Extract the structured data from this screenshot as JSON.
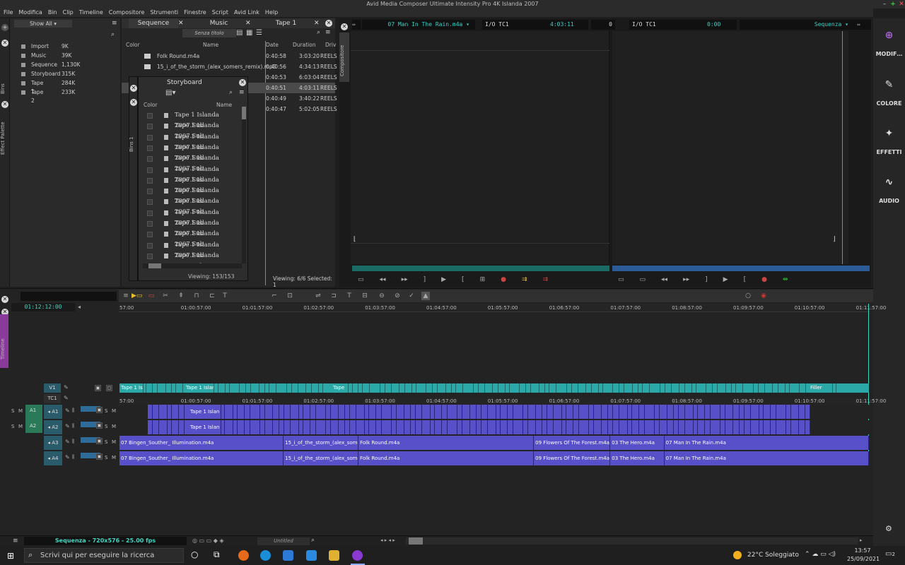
{
  "app": {
    "title": "Avid Media Composer Ultimate Intensity Pro 4K  Islanda 2007",
    "menu": [
      "File",
      "Modifica",
      "Bin",
      "Clip",
      "Timeline",
      "Compositore",
      "Strumenti",
      "Finestre",
      "Script",
      "Avid Link",
      "Help"
    ]
  },
  "project": {
    "filter": "Show All",
    "bins": [
      {
        "name": "Import",
        "size": "9K"
      },
      {
        "name": "Music",
        "size": "39K"
      },
      {
        "name": "Sequence",
        "size": "1,130K"
      },
      {
        "name": "Storyboard",
        "size": "315K"
      },
      {
        "name": "Tape 1",
        "size": "284K"
      },
      {
        "name": "Tape 2",
        "size": "233K"
      }
    ]
  },
  "left_tabs": {
    "bins": "Bins",
    "effect_palette": "Effect Palette"
  },
  "bin": {
    "tabs": [
      "Sequence",
      "Music",
      "Tape 1"
    ],
    "view_name": "Senza titolo",
    "columns": {
      "color": "Color",
      "name": "Name",
      "date": "Date",
      "duration": "Duration",
      "drive": "Driv"
    },
    "rows": [
      {
        "name": "Folk Round.m4a",
        "date": "0:40:58",
        "duration": "3:03:20",
        "drive": "REELS"
      },
      {
        "name": "15_i_of_the_storm_(alex_somers_remix).mp3",
        "date": "0:40:56",
        "duration": "4:34:13",
        "drive": "REELS"
      },
      {
        "name": "",
        "date": "0:40:53",
        "duration": "6:03:04",
        "drive": "REELS"
      },
      {
        "name": "",
        "date": "0:40:51",
        "duration": "4:03:11",
        "drive": "REELS"
      },
      {
        "name": "",
        "date": "0:40:49",
        "duration": "3:40:22",
        "drive": "REELS"
      },
      {
        "name": "",
        "date": "0:40:47",
        "duration": "5:02:05",
        "drive": "REELS"
      }
    ],
    "status": "Viewing: 6/6  Selected: 1"
  },
  "storyboard": {
    "title": "Storyboard",
    "side_tab": "Bins 1",
    "col_color": "Color",
    "col_name": "Name",
    "item_name": "Tape 1 Islanda 2007.Sub",
    "item_count": 14,
    "status": "Viewing: 153/153"
  },
  "composer": {
    "side_tab": "Compositore",
    "source_clip": "07 Man In The Rain.m4a",
    "source_tc_label": "I/O  TC1",
    "source_tc": "4:03:11",
    "source_counter": "0",
    "record_tc_label": "I/O  TC1",
    "record_tc": "0:00",
    "record_name": "Sequenza"
  },
  "sidebar": [
    {
      "label": "MODIF…",
      "icon": "edit-icon"
    },
    {
      "label": "COLORE",
      "icon": "brush-icon"
    },
    {
      "label": "EFFETTI",
      "icon": "wand-icon"
    },
    {
      "label": "AUDIO",
      "icon": "waveform-icon"
    }
  ],
  "timeline": {
    "side_tab": "Timeline",
    "timecode": "01:12:12:00",
    "ruler_ticks": [
      "57:00",
      "01:00:57:00",
      "01:01:57:00",
      "01:02:57:00",
      "01:03:57:00",
      "01:04:57:00",
      "01:05:57:00",
      "01:06:57:00",
      "01:07:57:00",
      "01:08:57:00",
      "01:09:57:00",
      "01:10:57:00",
      "01:11:57:00"
    ],
    "tracks": {
      "v1": "V1",
      "tc1": "TC1",
      "a1": "A1",
      "a2": "A2",
      "a3": "A3",
      "a4": "A4",
      "s": "S",
      "m": "M"
    },
    "video_labels": [
      "Tape 1 Is",
      "Tape 1 Islan",
      "Tape",
      "Filler"
    ],
    "audio12_label": "Tape 1 Islan",
    "audio_clips": [
      {
        "name": "07 Bingen_Souther_ Illumination.m4a",
        "start": 0,
        "end": 0.219
      },
      {
        "name": "15_i_of_the_storm_(alex_some",
        "start": 0.219,
        "end": 0.319
      },
      {
        "name": "Folk Round.m4a",
        "start": 0.319,
        "end": 0.553
      },
      {
        "name": "09 Flowers Of The Forest.m4a",
        "start": 0.553,
        "end": 0.655
      },
      {
        "name": "03 The Hero.m4a",
        "start": 0.655,
        "end": 0.727
      },
      {
        "name": "07 Man In The Rain.m4a",
        "start": 0.727,
        "end": 1.0
      }
    ],
    "sequence_info": "Sequenza - 720x576 - 25.00 fps",
    "untitled": "Untitled"
  },
  "taskbar": {
    "search_placeholder": "Scrivi qui per eseguire la ricerca",
    "weather": "22°C  Soleggiato",
    "time": "13:57",
    "date": "25/09/2021",
    "notifications": "2"
  },
  "colors": {
    "teal": "#2ba8a8",
    "purple": "#5750c9",
    "cyan_text": "#33d4c8"
  }
}
